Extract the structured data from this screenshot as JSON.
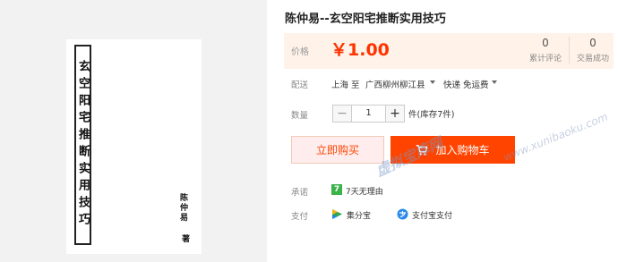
{
  "product": {
    "title": "陈仲易--玄空阳宅推断实用技巧",
    "cover": {
      "title": "玄空阳宅推断实用技巧",
      "author": "陈仲易",
      "suffix": "著"
    }
  },
  "price": {
    "label": "价格",
    "value": "￥1.00",
    "reviews_count": "0",
    "reviews_label": "累计评论",
    "trades_count": "0",
    "trades_label": "交易成功"
  },
  "shipping": {
    "label": "配送",
    "from": "上海 至",
    "to": "广西柳州柳江县",
    "method": "快递 免运费"
  },
  "quantity": {
    "label": "数量",
    "minus": "−",
    "value": "1",
    "plus": "+",
    "stock": "件(库存7件)"
  },
  "actions": {
    "buy_now": "立即购买",
    "add_to_cart": "加入购物车"
  },
  "promise": {
    "label": "承诺",
    "icon_text": "7",
    "text": "7天无理由"
  },
  "payment": {
    "label": "支付",
    "method1": "集分宝",
    "method2": "支付宝支付"
  },
  "watermark": {
    "cn": "虚拟宝库网",
    "en": "www.xunibaoku.com"
  },
  "colors": {
    "accent": "#ff4400",
    "price_bg": "#fff2e8"
  }
}
